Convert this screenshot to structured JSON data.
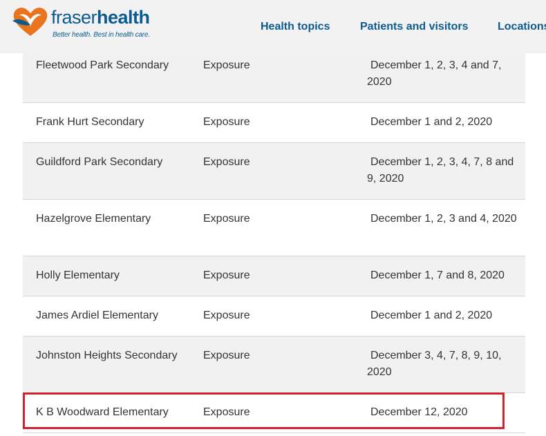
{
  "header": {
    "logo": {
      "name_light": "fraser",
      "name_bold": "health",
      "tagline": "Better health. Best in health care."
    },
    "nav": [
      {
        "label": "Health topics"
      },
      {
        "label": "Patients and visitors"
      },
      {
        "label": "Locations"
      }
    ]
  },
  "table": {
    "rows": [
      {
        "school": "Fleetwood Park Secondary",
        "type": "Exposure",
        "dates": "December 1, 2, 3, 4 and 7, 2020"
      },
      {
        "school": "Frank Hurt Secondary",
        "type": "Exposure",
        "dates": "December 1 and 2, 2020"
      },
      {
        "school": "Guildford Park Secondary",
        "type": "Exposure",
        "dates": "December 1, 2, 3, 4, 7, 8 and 9, 2020"
      },
      {
        "school": "Hazelgrove Elementary",
        "type": "Exposure",
        "dates": "December 1, 2, 3 and 4, 2020"
      },
      {
        "school": "Holly Elementary",
        "type": "Exposure",
        "dates": "December 1, 7 and 8, 2020"
      },
      {
        "school": "James Ardiel Elementary",
        "type": "Exposure",
        "dates": "December 1 and 2, 2020"
      },
      {
        "school": "Johnston Heights Secondary",
        "type": "Exposure",
        "dates": "December 3, 4, 7, 8, 9, 10, 2020"
      },
      {
        "school": "K B Woodward Elementary",
        "type": "Exposure",
        "dates": "December 12, 2020"
      }
    ]
  },
  "colors": {
    "brand_blue": "#0b5b8f",
    "brand_orange": "#e8741e",
    "highlight_red": "#d4202c"
  }
}
